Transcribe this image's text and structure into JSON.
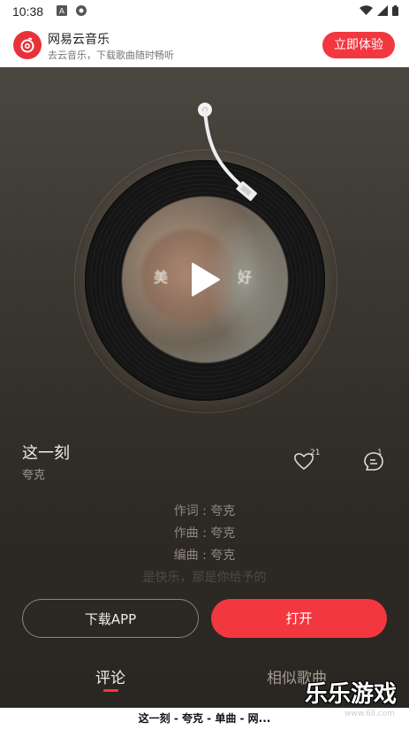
{
  "status_bar": {
    "time": "10:38"
  },
  "banner": {
    "app_name": "网易云音乐",
    "tagline": "去云音乐，下载歌曲随时畅听",
    "cta_label": "立即体验",
    "brand_color": "#e8323a"
  },
  "player": {
    "cover_text_left": "美",
    "cover_text_right": "好",
    "song_title": "这一刻",
    "artist": "夸克",
    "like_count": "21",
    "comment_count": "1",
    "lyrics": [
      "作词 : 夸克",
      "作曲 : 夸克",
      "编曲 : 夸克",
      "是快乐，那是你给予的"
    ]
  },
  "actions": {
    "download_label": "下载APP",
    "open_label": "打开",
    "accent": "#f2373f"
  },
  "tabs": [
    {
      "label": "评论",
      "active": true
    },
    {
      "label": "相似歌曲",
      "active": false
    }
  ],
  "watermark": {
    "text": "乐乐游戏",
    "url": "www.6ll.com"
  },
  "page_title_strip": "这一刻 - 夸克 - 单曲 - 网..."
}
